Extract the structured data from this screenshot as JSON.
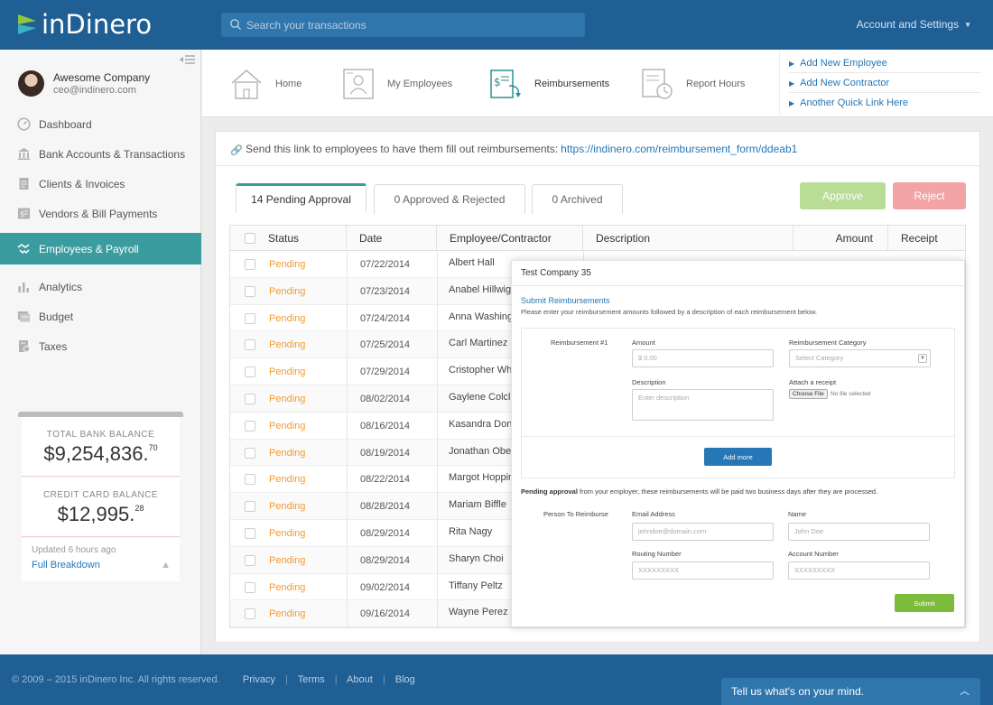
{
  "app": {
    "logo_text": "inDinero"
  },
  "search": {
    "placeholder": "Search your transactions"
  },
  "account_menu": {
    "label": "Account and Settings"
  },
  "profile": {
    "company": "Awesome Company",
    "email": "ceo@indinero.com"
  },
  "sidebar": {
    "items": [
      {
        "label": "Dashboard",
        "icon": "gauge-icon"
      },
      {
        "label": "Bank Accounts & Transactions",
        "icon": "bank-icon"
      },
      {
        "label": "Clients & Invoices",
        "icon": "document-icon"
      },
      {
        "label": "Vendors & Bill Payments",
        "icon": "bill-icon"
      },
      {
        "label": "Employees & Payroll",
        "icon": "handshake-icon",
        "active": true
      },
      {
        "label": "Analytics",
        "icon": "bar-chart-icon"
      },
      {
        "label": "Budget",
        "icon": "budget-icon"
      },
      {
        "label": "Taxes",
        "icon": "taxes-icon"
      }
    ]
  },
  "balances": {
    "bank_label": "TOTAL BANK BALANCE",
    "bank_amount": "$9,254,836.",
    "bank_cents": "70",
    "cc_label": "CREDIT CARD BALANCE",
    "cc_amount": "$12,995.",
    "cc_cents": "28",
    "updated": "Updated 6 hours ago",
    "breakdown": "Full Breakdown"
  },
  "quicknav": {
    "tabs": [
      {
        "label": "Home",
        "icon": "house-icon"
      },
      {
        "label": "My Employees",
        "icon": "employee-card-icon"
      },
      {
        "label": "Reimbursements",
        "icon": "reimbursement-icon",
        "active": true
      },
      {
        "label": "Report Hours",
        "icon": "clock-report-icon"
      }
    ],
    "quick_links": [
      "Add New Employee",
      "Add New Contractor",
      "Another Quick Link Here"
    ]
  },
  "linkbar": {
    "text": "Send this link to employees to have them fill out reimbursements:",
    "url": "https://indinero.com/reimbursement_form/ddeab1"
  },
  "tabs": [
    "14 Pending Approval",
    "0 Approved & Rejected",
    "0 Archived"
  ],
  "actions": {
    "approve": "Approve",
    "reject": "Reject"
  },
  "table": {
    "headers": [
      "Status",
      "Date",
      "Employee/Contractor",
      "Description",
      "Amount",
      "Receipt"
    ],
    "rows": [
      {
        "status": "Pending",
        "date": "07/22/2014",
        "employee": "Albert Hall"
      },
      {
        "status": "Pending",
        "date": "07/23/2014",
        "employee": "Anabel Hillwig"
      },
      {
        "status": "Pending",
        "date": "07/24/2014",
        "employee": "Anna Washing"
      },
      {
        "status": "Pending",
        "date": "07/25/2014",
        "employee": "Carl Martinez"
      },
      {
        "status": "Pending",
        "date": "07/29/2014",
        "employee": "Cristopher Wh"
      },
      {
        "status": "Pending",
        "date": "08/02/2014",
        "employee": "Gaylene Colclo"
      },
      {
        "status": "Pending",
        "date": "08/16/2014",
        "employee": "Kasandra Dona"
      },
      {
        "status": "Pending",
        "date": "08/19/2014",
        "employee": "Jonathan Ober"
      },
      {
        "status": "Pending",
        "date": "08/22/2014",
        "employee": "Margot Hoppin"
      },
      {
        "status": "Pending",
        "date": "08/28/2014",
        "employee": "Mariam Biffle"
      },
      {
        "status": "Pending",
        "date": "08/29/2014",
        "employee": "Rita Nagy"
      },
      {
        "status": "Pending",
        "date": "08/29/2014",
        "employee": "Sharyn Choi"
      },
      {
        "status": "Pending",
        "date": "09/02/2014",
        "employee": "Tiffany Peltz"
      },
      {
        "status": "Pending",
        "date": "09/16/2014",
        "employee": "Wayne Perez"
      }
    ]
  },
  "modal": {
    "title": "Test Company 35",
    "subtitle": "Submit Reimbursements",
    "description": "Please enter your reimbursement amounts followed by a description of each reimbursement below.",
    "reimb_label": "Reimbursement #1",
    "amount_label": "Amount",
    "amount_placeholder": "$ 0.00",
    "category_label": "Reimbursement Category",
    "category_placeholder": "Select Category",
    "desc_label": "Description",
    "desc_placeholder": "Enter description",
    "attach_label": "Attach a receipt",
    "choose_file": "Choose File",
    "no_file": "No file selected",
    "add_more": "Add more",
    "pending_bold": "Pending approval",
    "pending_rest": " from your employer, these reimbursements will be paid two business days after they are processed.",
    "person_label": "Person To Reimburse",
    "email_label": "Email Address",
    "email_placeholder": "johndoe@domain.com",
    "name_label": "Name",
    "name_placeholder": "John Doe",
    "routing_label": "Routing Number",
    "routing_placeholder": "XXXXXXXXX",
    "account_label": "Account Number",
    "account_placeholder": "XXXXXXXXX",
    "submit": "Submit"
  },
  "footer": {
    "copyright": "© 2009 – 2015 inDinero Inc. All rights reserved.",
    "links": [
      "Privacy",
      "Terms",
      "About",
      "Blog"
    ],
    "feedback": "Tell us what's on your mind."
  },
  "colors": {
    "brand_blue": "#1f5f94",
    "teal": "#3b9c9f",
    "pending_orange": "#f39b2f",
    "link_blue": "#2577b5",
    "approve_green": "#b9dc96",
    "reject_red": "#f2a3a6"
  }
}
